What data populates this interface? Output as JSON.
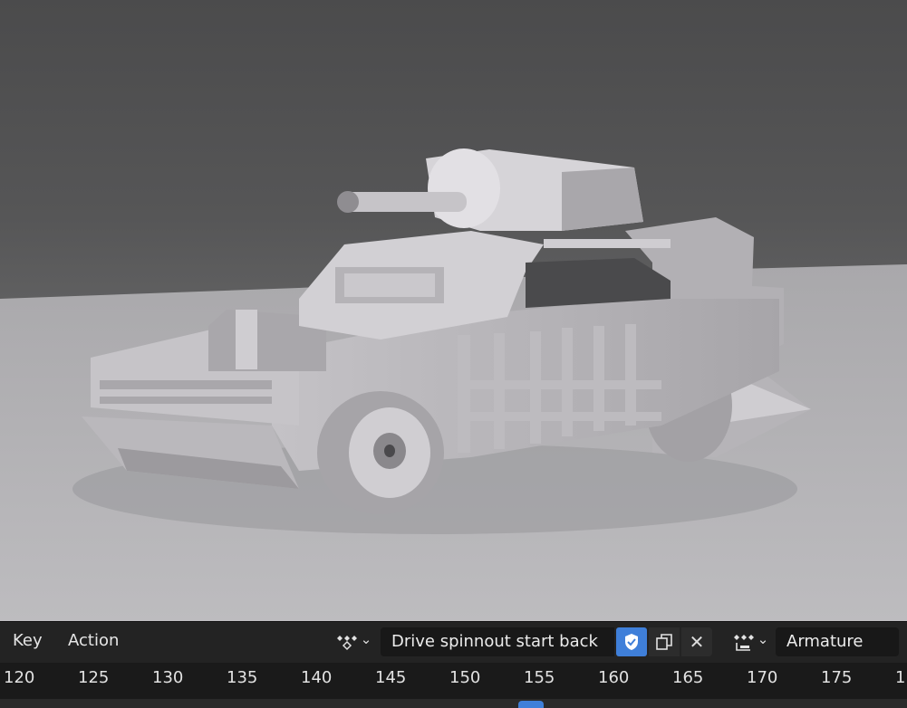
{
  "header": {
    "menu": [
      {
        "label": "Key"
      },
      {
        "label": "Action"
      }
    ],
    "action_browse_icon": "action-icon",
    "action_name": "Drive spinnout start back",
    "fake_user_icon": "shield-icon",
    "duplicate_icon": "duplicate-icon",
    "unlink_icon": "close-icon",
    "unlink_glyph": "✕",
    "object_type_icon": "armature-icon",
    "object_name": "Armature",
    "dropdown_glyph": "⌄"
  },
  "timeline": {
    "frames": [
      "120",
      "125",
      "130",
      "135",
      "140",
      "145",
      "150",
      "155",
      "160",
      "165",
      "170",
      "175",
      "1"
    ]
  },
  "colors": {
    "accent": "#3f7fd9",
    "header_bg": "#232323",
    "field_bg": "#181818"
  }
}
